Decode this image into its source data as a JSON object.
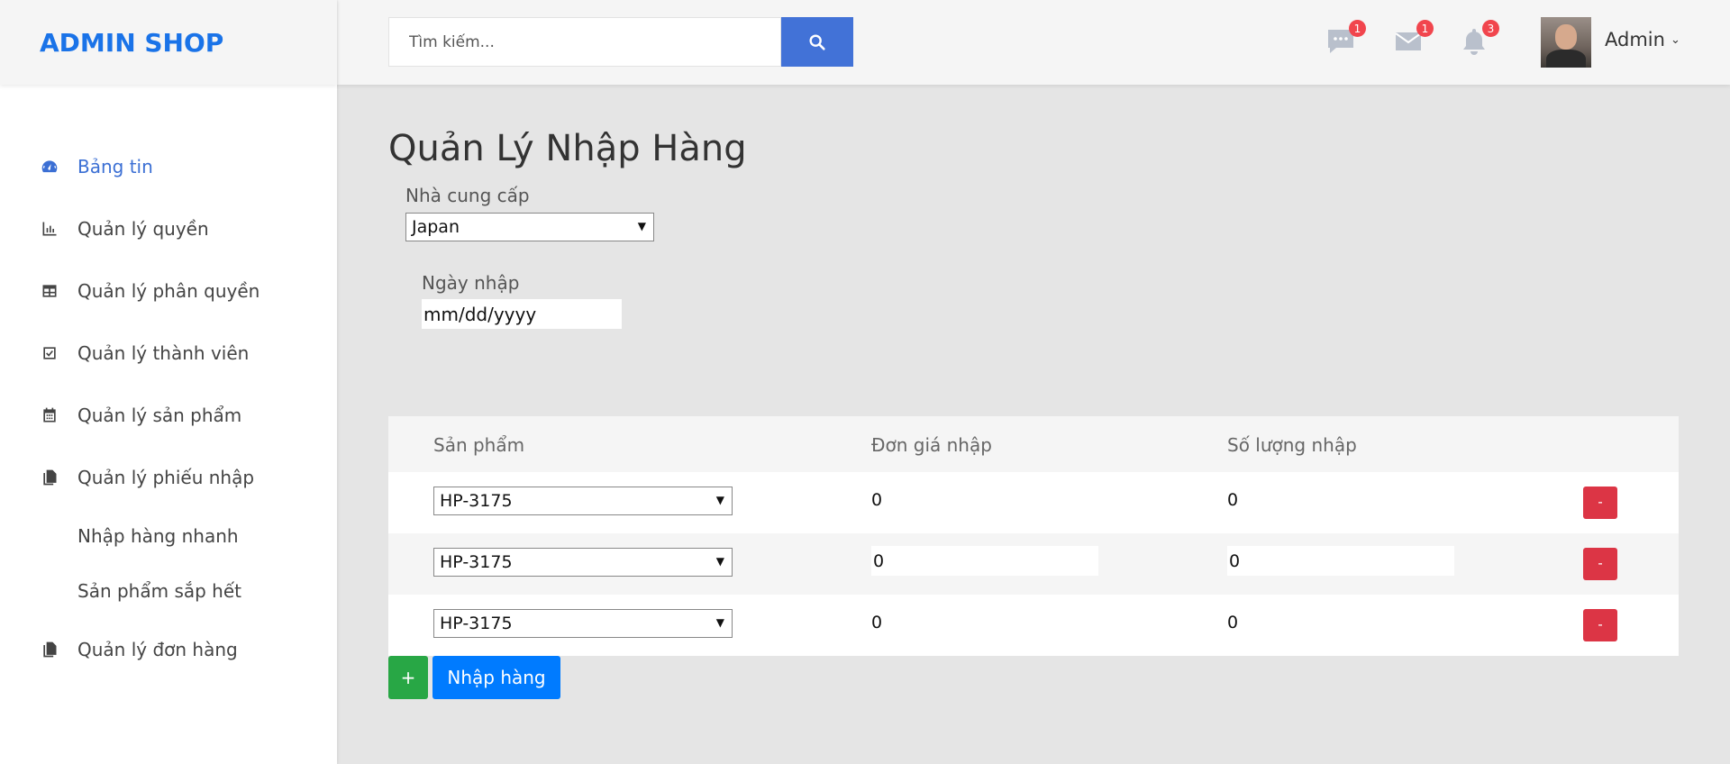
{
  "brand": {
    "logo_text": "ADMIN SHOP",
    "accent": "#1a73e8"
  },
  "sidebar": {
    "items": [
      {
        "label": "Bảng tin",
        "icon": "dashboard-icon",
        "active": true
      },
      {
        "label": "Quản lý quyền",
        "icon": "bar-chart-icon"
      },
      {
        "label": "Quản lý phân quyền",
        "icon": "table-icon"
      },
      {
        "label": "Quản lý thành viên",
        "icon": "checkbox-icon"
      },
      {
        "label": "Quản lý sản phẩm",
        "icon": "calendar-icon"
      },
      {
        "label": "Quản lý phiếu nhập",
        "icon": "copy-icon"
      },
      {
        "label": "Nhập hàng nhanh",
        "sub": true
      },
      {
        "label": "Sản phẩm sắp hết",
        "sub": true
      },
      {
        "label": "Quản lý đơn hàng",
        "icon": "copy-icon"
      }
    ]
  },
  "header": {
    "search_placeholder": "Tìm kiếm...",
    "chat_badge": "1",
    "mail_badge": "1",
    "notification_badge": "3",
    "user_name": "Admin"
  },
  "main": {
    "title": "Quản Lý Nhập Hàng",
    "supplier_label": "Nhà cung cấp",
    "supplier_value": "Japan",
    "date_label": "Ngày nhập",
    "date_placeholder": "mm/dd/yyyy",
    "table": {
      "headers": [
        "Sản phẩm",
        "Đơn giá nhập",
        "Số lượng nhập"
      ],
      "rows": [
        {
          "product": "HP-3175",
          "price": "0",
          "quantity": "0",
          "remove": "-"
        },
        {
          "product": "HP-3175",
          "price": "0",
          "quantity": "0",
          "remove": "-"
        },
        {
          "product": "HP-3175",
          "price": "0",
          "quantity": "0",
          "remove": "-"
        }
      ]
    },
    "add_label": "+",
    "submit_label": "Nhập hàng"
  },
  "colors": {
    "primary": "#007bff",
    "success": "#28a745",
    "danger": "#dc3545",
    "search_button": "#4272d7",
    "badge": "#f1454d"
  }
}
